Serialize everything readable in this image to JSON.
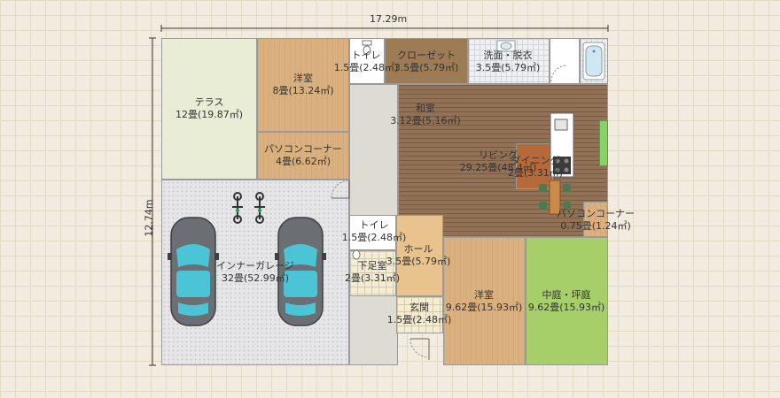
{
  "dimensions": {
    "width": "17.29m",
    "height": "12.74m"
  },
  "rooms": {
    "terrace": {
      "name": "テラス",
      "size": "12畳(19.87㎡)"
    },
    "western_north": {
      "name": "洋室",
      "size": "8畳(13.24㎡)"
    },
    "pc_corner_n": {
      "name": "パソコンコーナー",
      "size": "4畳(6.62㎡)"
    },
    "toilet_n": {
      "name": "トイレ",
      "size": "1.5畳(2.48㎡)"
    },
    "closet": {
      "name": "クローゼット",
      "size": "3.5畳(5.79㎡)"
    },
    "washroom": {
      "name": "洗面・脱衣",
      "size": "3.5畳(5.79㎡)"
    },
    "washitsu": {
      "name": "和室",
      "size": "3.12畳(5.16㎡)"
    },
    "living": {
      "name": "リビング",
      "size": "29.25畳(48.4㎡)"
    },
    "dining": {
      "name": "ダイニング",
      "size": "2畳(3.31㎡)"
    },
    "pc_corner_e": {
      "name": "パソコンコーナー",
      "size": "0.75畳(1.24㎡)"
    },
    "garage": {
      "name": "インナーガレージ",
      "size": "32畳(52.99㎡)"
    },
    "toilet_s": {
      "name": "トイレ",
      "size": "1.5畳(2.48㎡)"
    },
    "hall": {
      "name": "ホール",
      "size": "3.5畳(5.79㎡)"
    },
    "shoe_room": {
      "name": "下足室",
      "size": "2畳(3.31㎡)"
    },
    "entrance": {
      "name": "玄関",
      "size": "1.5畳(2.48㎡)"
    },
    "western_south": {
      "name": "洋室",
      "size": "9.62畳(15.93㎡)"
    },
    "courtyard": {
      "name": "中庭・坪庭",
      "size": "9.62畳(15.93㎡)"
    }
  },
  "icons": {
    "car": "car-icon",
    "bicycle": "bicycle-icon",
    "bathtub": "bathtub-icon",
    "kitchen": "kitchen-counter-icon",
    "door": "door-swing-icon"
  },
  "colors": {
    "terrace": "#e9edd5",
    "western": "#d9b07e",
    "wood": "#8b6a4f",
    "courtyard": "#a6cf6a",
    "car_glass": "#4bc4d6",
    "car_body": "#6b6e72"
  }
}
